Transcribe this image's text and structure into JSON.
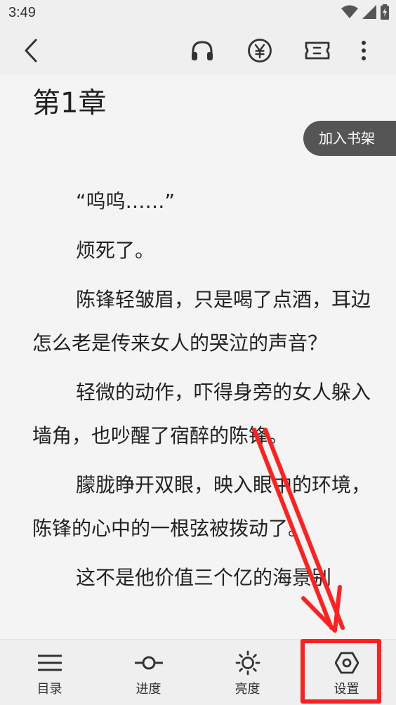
{
  "status_bar": {
    "time": "3:49",
    "icons": [
      "wifi-icon",
      "signal-icon",
      "battery-icon"
    ]
  },
  "toolbar": {
    "icons": [
      "back-icon",
      "headphones-icon",
      "yuan-icon",
      "ticket-icon",
      "more-icon"
    ]
  },
  "chapter": {
    "title": "第1章"
  },
  "add_to_shelf_label": "加入书架",
  "paragraphs": [
    "“呜呜……”",
    "烦死了。",
    "陈锋轻皱眉，只是喝了点酒，耳边怎么老是传来女人的哭泣的声音？",
    "轻微的动作，吓得身旁的女人躲入墙角，也吵醒了宿醉的陈锋。",
    "朦胧睁开双眼，映入眼中的环境，陈锋的心中的一根弦被拨动了。",
    "这不是他价值三个亿的海景别"
  ],
  "bottom_nav": [
    {
      "label": "目录",
      "icon": "menu-icon"
    },
    {
      "label": "进度",
      "icon": "progress-icon"
    },
    {
      "label": "亮度",
      "icon": "brightness-icon"
    },
    {
      "label": "设置",
      "icon": "settings-icon"
    }
  ],
  "annotation": {
    "color": "#ff2020"
  }
}
